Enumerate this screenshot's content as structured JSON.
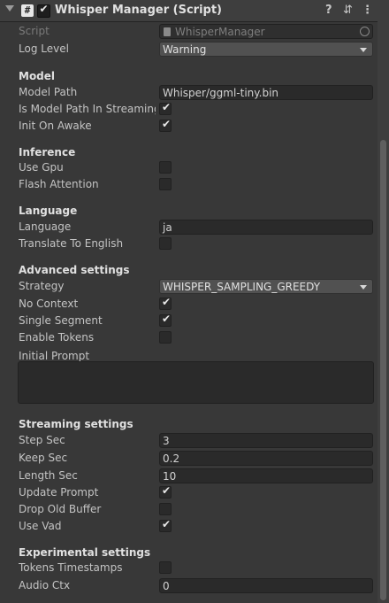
{
  "header": {
    "title": "Whisper Manager (Script)",
    "script_glyph": "#",
    "help": "?",
    "settings": "⇵",
    "more": "⋮"
  },
  "fields": {
    "script": {
      "label": "Script",
      "value": "WhisperManager"
    },
    "log_level": {
      "label": "Log Level",
      "value": "Warning"
    }
  },
  "model": {
    "heading": "Model",
    "path": {
      "label": "Model Path",
      "value": "Whisper/ggml-tiny.bin"
    },
    "streaming": {
      "label": "Is Model Path In Streaming A",
      "checked": true
    },
    "init": {
      "label": "Init On Awake",
      "checked": true
    }
  },
  "inference": {
    "heading": "Inference",
    "gpu": {
      "label": "Use Gpu",
      "checked": false
    },
    "flash": {
      "label": "Flash Attention",
      "checked": false
    }
  },
  "language": {
    "heading": "Language",
    "lang": {
      "label": "Language",
      "value": "ja"
    },
    "translate": {
      "label": "Translate To English",
      "checked": false
    }
  },
  "advanced": {
    "heading": "Advanced settings",
    "strategy": {
      "label": "Strategy",
      "value": "WHISPER_SAMPLING_GREEDY"
    },
    "no_context": {
      "label": "No Context",
      "checked": true
    },
    "single_segment": {
      "label": "Single Segment",
      "checked": true
    },
    "enable_tokens": {
      "label": "Enable Tokens",
      "checked": false
    },
    "initial_prompt": {
      "label": "Initial Prompt",
      "value": ""
    }
  },
  "streaming": {
    "heading": "Streaming settings",
    "step": {
      "label": "Step Sec",
      "value": "3"
    },
    "keep": {
      "label": "Keep Sec",
      "value": "0.2"
    },
    "length": {
      "label": "Length Sec",
      "value": "10"
    },
    "update_prompt": {
      "label": "Update Prompt",
      "checked": true
    },
    "drop_old": {
      "label": "Drop Old Buffer",
      "checked": false
    },
    "vad": {
      "label": "Use Vad",
      "checked": true
    }
  },
  "experimental": {
    "heading": "Experimental settings",
    "tokens_ts": {
      "label": "Tokens Timestamps",
      "checked": false
    },
    "audio_ctx": {
      "label": "Audio Ctx",
      "value": "0"
    }
  },
  "check_glyph": "✔"
}
